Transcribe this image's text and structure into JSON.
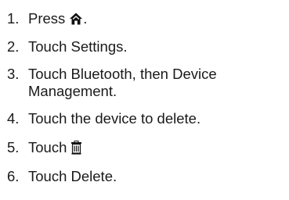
{
  "steps": [
    {
      "number": "1.",
      "text": "Press",
      "icon": "home-icon",
      "suffix": "."
    },
    {
      "number": "2.",
      "text": "Touch Settings."
    },
    {
      "number": "3.",
      "line1": "Touch Bluetooth, then Device",
      "line2": "Management."
    },
    {
      "number": "4.",
      "text": "Touch the device to delete."
    },
    {
      "number": "5.",
      "text": "Touch",
      "icon": "trash-icon"
    },
    {
      "number": "6.",
      "text": "Touch Delete."
    }
  ]
}
